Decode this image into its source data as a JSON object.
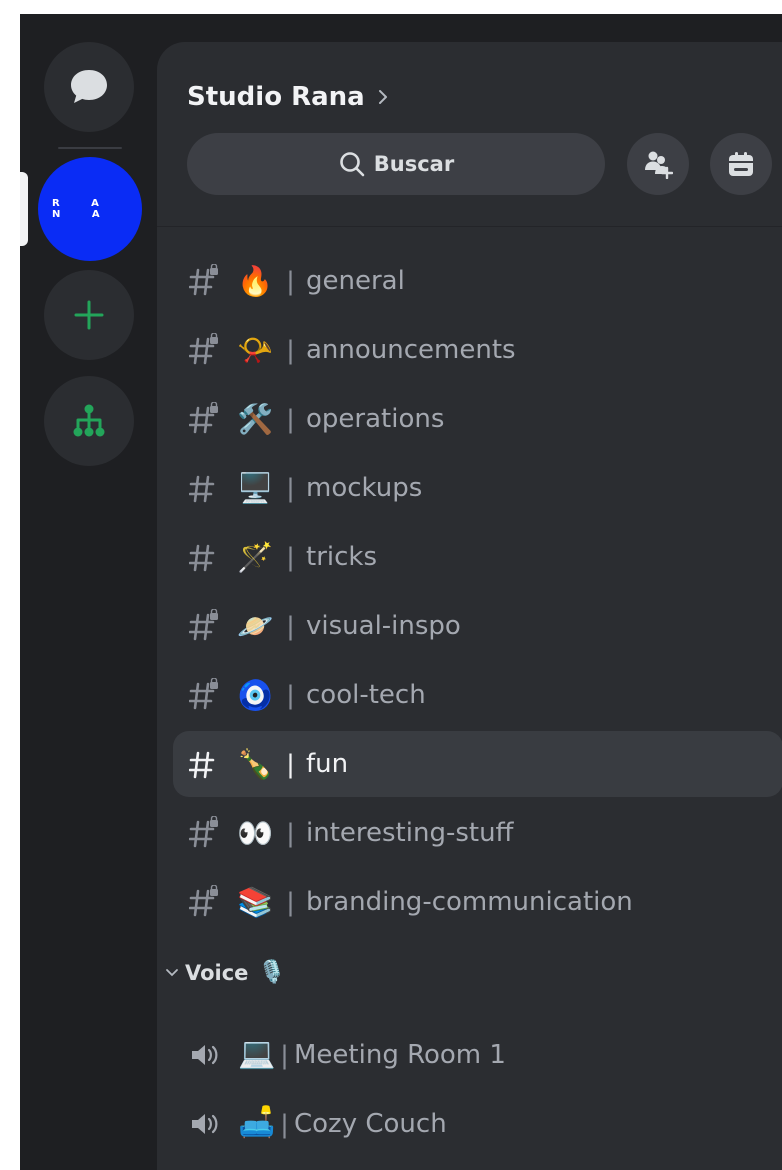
{
  "rail": {
    "dm_icon": "chat-bubble-icon",
    "server_logo_text": "R A N A",
    "add_icon": "plus-icon",
    "discover_icon": "hierarchy-icon",
    "accent_green": "#23a55a",
    "server_color": "#0a2cf5"
  },
  "header": {
    "server_name": "Studio Rana",
    "chevron": "›"
  },
  "search": {
    "label": "Buscar"
  },
  "actions": {
    "invite_icon": "add-member-icon",
    "events_icon": "calendar-icon"
  },
  "channels": [
    {
      "emoji": "🔥",
      "sep": "|",
      "name": "general",
      "locked": true,
      "active": false
    },
    {
      "emoji": "📯",
      "sep": "|",
      "name": "announcements",
      "locked": true,
      "active": false
    },
    {
      "emoji": "🛠️",
      "sep": "|",
      "name": "operations",
      "locked": true,
      "active": false
    },
    {
      "emoji": "🖥️",
      "sep": "|",
      "name": "mockups",
      "locked": false,
      "active": false
    },
    {
      "emoji": "🪄",
      "sep": "|",
      "name": "tricks",
      "locked": false,
      "active": false
    },
    {
      "emoji": "🪐",
      "sep": "|",
      "name": "visual-inspo",
      "locked": true,
      "active": false
    },
    {
      "emoji": "🧿",
      "sep": "|",
      "name": "cool-tech",
      "locked": true,
      "active": false
    },
    {
      "emoji": "🍾",
      "sep": "|",
      "name": "fun",
      "locked": false,
      "active": true
    },
    {
      "emoji": "👀",
      "sep": "|",
      "name": "interesting-stuff",
      "locked": true,
      "active": false
    },
    {
      "emoji": "📚",
      "sep": "|",
      "name": "branding-communication",
      "locked": true,
      "active": false
    }
  ],
  "voice_category": {
    "label": "Voice",
    "emoji": "🎙️"
  },
  "voice_channels": [
    {
      "emoji": "💻",
      "sep": "|",
      "name": "Meeting Room 1"
    },
    {
      "emoji": "🛋️",
      "sep": "|",
      "name": "Cozy Couch"
    }
  ]
}
